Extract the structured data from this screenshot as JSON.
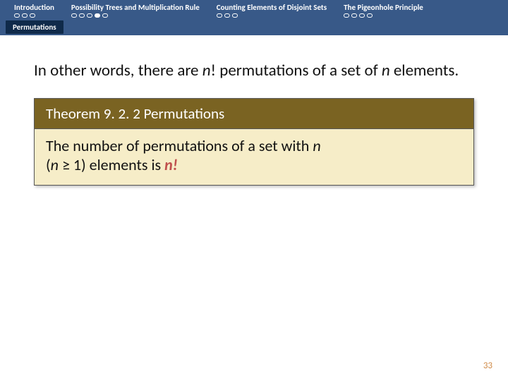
{
  "nav": {
    "items": [
      {
        "label": "Introduction",
        "dots": 3,
        "active": -1
      },
      {
        "label": "Possibility Trees and Multiplication Rule",
        "dots": 5,
        "active": 3
      },
      {
        "label": "Counting Elements of Disjoint Sets",
        "dots": 3,
        "active": -1
      },
      {
        "label": "The Pigeonhole Principle",
        "dots": 4,
        "active": -1
      }
    ],
    "active_tab": "Permutations"
  },
  "lead": {
    "pre": "In other words, there are ",
    "n": "n",
    "mid": "! permutations of a set of ",
    "n2": "n",
    "post": " elements."
  },
  "theorem": {
    "title": "Theorem 9. 2. 2 Permutations",
    "body_pre": "The number of permutations of a set with ",
    "body_n": "n",
    "body_paren_open": "(",
    "body_n2": "n",
    "body_ge": " ≥ 1) elements is ",
    "body_em": "n!"
  },
  "page_number": "33"
}
